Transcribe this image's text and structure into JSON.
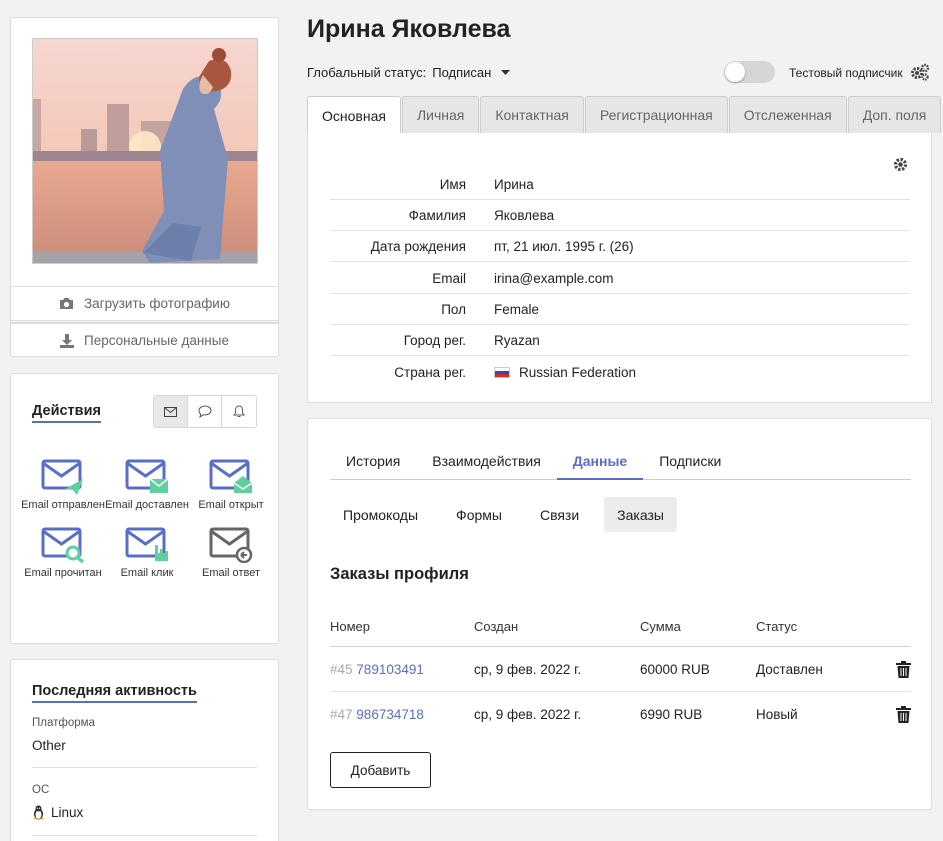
{
  "profile": {
    "name": "Ирина Яковлева",
    "global_status_label": "Глобальный статус:",
    "global_status_value": "Подписан",
    "test_subscriber_label": "Тестовый подписчик",
    "test_subscriber_enabled": false
  },
  "photo_card": {
    "upload_label": "Загрузить фотографию",
    "personal_data_label": "Персональные данные"
  },
  "actions": {
    "title": "Действия",
    "channels": [
      "email-icon",
      "chat-icon",
      "bell-icon"
    ],
    "active_channel": "email-icon",
    "items": [
      {
        "label": "Email отправлен",
        "icon": "email-sent-icon"
      },
      {
        "label": "Email доставлен",
        "icon": "email-delivered-icon"
      },
      {
        "label": "Email открыт",
        "icon": "email-opened-icon"
      },
      {
        "label": "Email прочитан",
        "icon": "email-read-icon"
      },
      {
        "label": "Email клик",
        "icon": "email-click-icon"
      },
      {
        "label": "Email ответ",
        "icon": "email-reply-icon"
      }
    ]
  },
  "activity": {
    "title": "Последняя активность",
    "platform_label": "Платформа",
    "platform_value": "Other",
    "os_label": "ОС",
    "os_value": "Linux"
  },
  "tabs": [
    "Основная",
    "Личная",
    "Контактная",
    "Регистрационная",
    "Отслеженная",
    "Доп. поля"
  ],
  "active_tab": "Основная",
  "fields": [
    {
      "label": "Имя",
      "value": "Ирина"
    },
    {
      "label": "Фамилия",
      "value": "Яковлева"
    },
    {
      "label": "Дата рождения",
      "value": "пт, 21 июл. 1995 г. (26)"
    },
    {
      "label": "Email",
      "value": "irina@example.com"
    },
    {
      "label": "Пол",
      "value": "Female"
    },
    {
      "label": "Город рег.",
      "value": "Ryazan"
    },
    {
      "label": "Страна рег.",
      "value": "Russian Federation"
    }
  ],
  "data_section": {
    "subtabs": [
      "История",
      "Взаимодействия",
      "Данные",
      "Подписки"
    ],
    "active_subtab": "Данные",
    "pills": [
      "Промокоды",
      "Формы",
      "Связи",
      "Заказы"
    ],
    "active_pill": "Заказы",
    "orders_title": "Заказы профиля",
    "columns": [
      "Номер",
      "Создан",
      "Сумма",
      "Статус"
    ],
    "orders": [
      {
        "hash": "#45",
        "number": "789103491",
        "created": "ср, 9 фев. 2022 г.",
        "amount": "60000 RUB",
        "status": "Доставлен"
      },
      {
        "hash": "#47",
        "number": "986734718",
        "created": "ср, 9 фев. 2022 г.",
        "amount": "6990 RUB",
        "status": "Новый"
      }
    ],
    "add_label": "Добавить"
  },
  "colors": {
    "accent": "#5a6ec8",
    "icon_blue": "#5a6ec8",
    "icon_green": "#5fcf9f",
    "icon_gray": "#666666"
  }
}
